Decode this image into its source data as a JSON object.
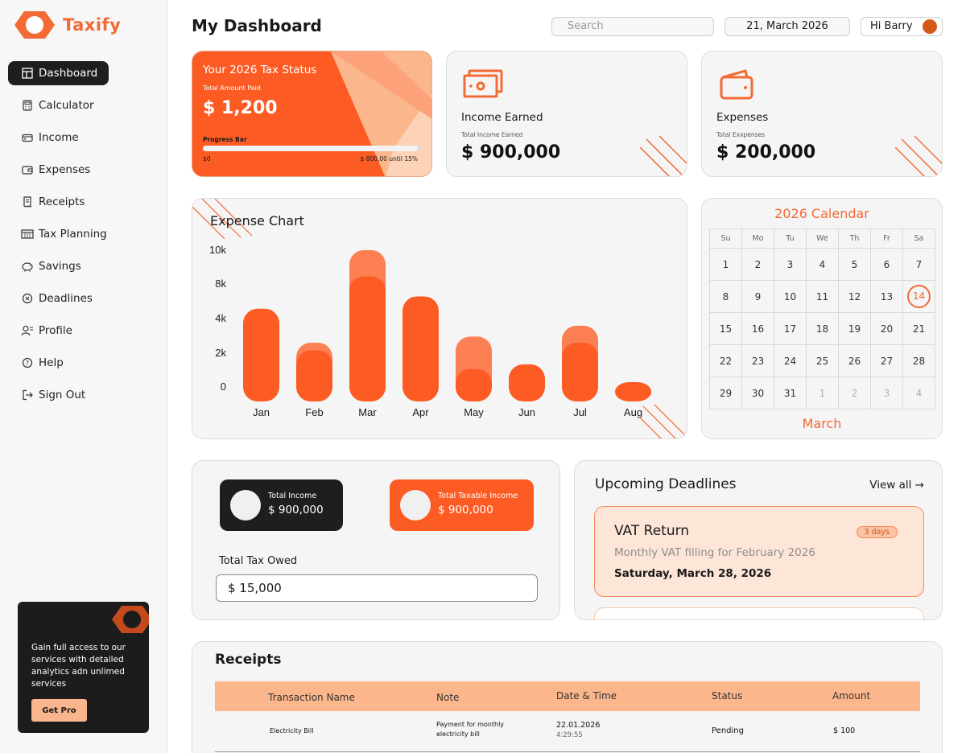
{
  "app": {
    "name": "Taxify",
    "page_title": "My Dashboard"
  },
  "colors": {
    "accent": "#fd5b24",
    "accent_light": "#fcb68b",
    "dark": "#1e1e1e"
  },
  "sidebar": {
    "items": [
      {
        "label": "Dashboard",
        "icon": "dashboard-icon",
        "active": true
      },
      {
        "label": "Calculator",
        "icon": "calculator-icon"
      },
      {
        "label": "Income",
        "icon": "income-icon"
      },
      {
        "label": "Expenses",
        "icon": "wallet-icon"
      },
      {
        "label": "Receipts",
        "icon": "receipt-icon"
      },
      {
        "label": "Tax Planning",
        "icon": "calendar-icon"
      },
      {
        "label": "Savings",
        "icon": "piggy-bank-icon"
      },
      {
        "label": "Deadlines",
        "icon": "clock-x-icon"
      },
      {
        "label": "Profile",
        "icon": "user-icon"
      },
      {
        "label": "Help",
        "icon": "help-icon"
      },
      {
        "label": "Sign Out",
        "icon": "sign-out-icon"
      }
    ],
    "promo": {
      "text": "Gain full access to our services with detailed analytics adn unlimed services",
      "button": "Get Pro"
    }
  },
  "header": {
    "search_placeholder": "Search",
    "date": "21, March 2026",
    "greeting": "Hi Barry"
  },
  "tax_status": {
    "title": "Your 2026 Tax Status",
    "paid_label": "Total Amount Paid",
    "paid_value": "$ 1,200",
    "progress_label": "Progress Bar",
    "progress_fraction": 0.985,
    "progress_start": "$0",
    "progress_end": "$ 800,00 until 15%"
  },
  "income": {
    "title": "Income Earned",
    "sub": "Total Income Earned",
    "value": "$ 900,000",
    "icon": "cash-icon"
  },
  "expenses": {
    "title": "Expenses",
    "sub": "Total Exxpenses",
    "value": "$ 200,000",
    "icon": "wallet-icon"
  },
  "chart_data": {
    "type": "bar",
    "title": "Expense Chart",
    "categories": [
      "Jan",
      "Feb",
      "Mar",
      "Apr",
      "May",
      "Jun",
      "Jul",
      "Aug"
    ],
    "series": [
      {
        "values": [
          6000,
          3300,
          8100,
          6800,
          2100,
          2400,
          3800,
          1200
        ],
        "color": "#fd5b24"
      },
      {
        "values": [
          6000,
          3800,
          9800,
          6800,
          4200,
          2400,
          4900,
          1200
        ],
        "color": "#fd7f54"
      }
    ],
    "y_ticks": [
      "10k",
      "8k",
      "4k",
      "2k",
      "0"
    ],
    "ylim": [
      0,
      10000
    ],
    "grid": false
  },
  "calendar": {
    "title": "2026 Calendar",
    "month": "March",
    "weekdays": [
      "Su",
      "Mo",
      "Tu",
      "We",
      "Th",
      "Fr",
      "Sa"
    ],
    "weeks": [
      [
        "1",
        "2",
        "3",
        "4",
        "5",
        "6",
        "7"
      ],
      [
        "8",
        "9",
        "10",
        "11",
        "12",
        "13",
        "14"
      ],
      [
        "15",
        "16",
        "17",
        "18",
        "19",
        "20",
        "21"
      ],
      [
        "22",
        "23",
        "24",
        "25",
        "26",
        "27",
        "28"
      ],
      [
        "29",
        "30",
        "31",
        "1",
        "2",
        "3",
        "4"
      ]
    ],
    "today": "14"
  },
  "summary": {
    "total_income_label": "Total Income",
    "total_income_value": "$ 900,000",
    "taxable_income_label": "Total Taxable Income",
    "taxable_income_value": "$ 900,000",
    "tax_owed_label": "Total Tax Owed",
    "tax_owed_value": "$ 15,000"
  },
  "deadlines": {
    "title": "Upcoming Deadlines",
    "view_all": "View all →",
    "items": [
      {
        "name": "VAT Return",
        "badge": "3 days",
        "description": "Monthly VAT filling for February 2026",
        "date": "Saturday, March 28, 2026"
      }
    ]
  },
  "receipts": {
    "title": "Receipts",
    "columns": [
      "Transaction Name",
      "Note",
      "Date & Time",
      "Status",
      "Amount"
    ],
    "rows": [
      {
        "name": "Electricity Bill",
        "note_line1": "Payment for monthly",
        "note_line2": "electricity bill",
        "date": "22.01.2026",
        "time": "4:29:55",
        "status": "Pending",
        "amount": "$ 100"
      }
    ]
  }
}
